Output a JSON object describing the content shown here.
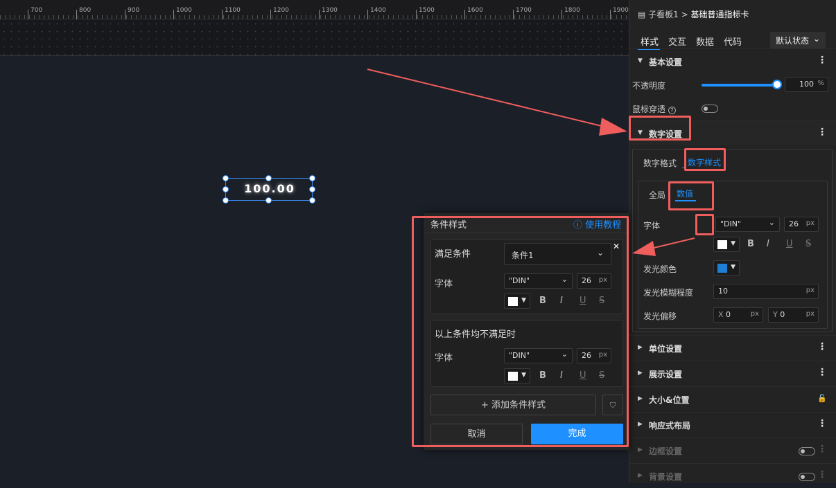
{
  "ruler": {
    "ticks": [
      "700",
      "800",
      "900",
      "1000",
      "1100",
      "1200",
      "1300",
      "1400",
      "1500",
      "1600",
      "1700",
      "1800",
      "1900"
    ]
  },
  "canvas": {
    "widget_value": "100.00"
  },
  "panel": {
    "breadcrumb": {
      "parent": "子看板1",
      "separator": ">",
      "current": "基础普通指标卡"
    },
    "tabs": [
      "样式",
      "交互",
      "数据",
      "代码"
    ],
    "state_select": "默认状态",
    "sections": {
      "basic": {
        "title": "基本设置",
        "opacity_label": "不透明度",
        "opacity_value": "100",
        "opacity_unit": "%",
        "mouse_through_label": "鼠标穿透",
        "help_icon": "?"
      },
      "number": {
        "title": "数字设置",
        "subtabs": [
          "数字格式",
          "数字样式"
        ],
        "inner_tabs": [
          "全局",
          "数值"
        ],
        "font_label": "字体",
        "font_value": "\"DIN\"",
        "font_size": "26",
        "px": "px",
        "glow_color_label": "发光颜色",
        "glow_blur_label": "发光模糊程度",
        "glow_blur_value": "10",
        "glow_offset_label": "发光偏移",
        "offset_x_label": "X",
        "offset_x": "0",
        "offset_y_label": "Y",
        "offset_y": "0",
        "text_color": "#ffffff",
        "glow_color": "#1e7fd6"
      },
      "unit": {
        "title": "单位设置"
      },
      "display": {
        "title": "展示设置"
      },
      "size": {
        "title": "大小&位置"
      },
      "responsive": {
        "title": "响应式布局"
      },
      "border": {
        "title": "边框设置"
      },
      "background": {
        "title": "背景设置"
      }
    },
    "format_buttons": [
      "B",
      "I",
      "U",
      "S"
    ]
  },
  "dialog": {
    "title": "条件样式",
    "tutorial": "使用教程",
    "close": "✕",
    "cond": {
      "label": "满足条件",
      "select": "条件1",
      "font_label": "字体",
      "font": "\"DIN\"",
      "size": "26",
      "px": "px"
    },
    "else": {
      "label": "以上条件均不满足时",
      "font_label": "字体",
      "font": "\"DIN\"",
      "size": "26",
      "px": "px"
    },
    "add_button": "+ 添加条件样式",
    "cancel": "取消",
    "done": "完成"
  },
  "colors": {
    "accent": "#1e90ff",
    "annotation": "#f05d5d"
  }
}
